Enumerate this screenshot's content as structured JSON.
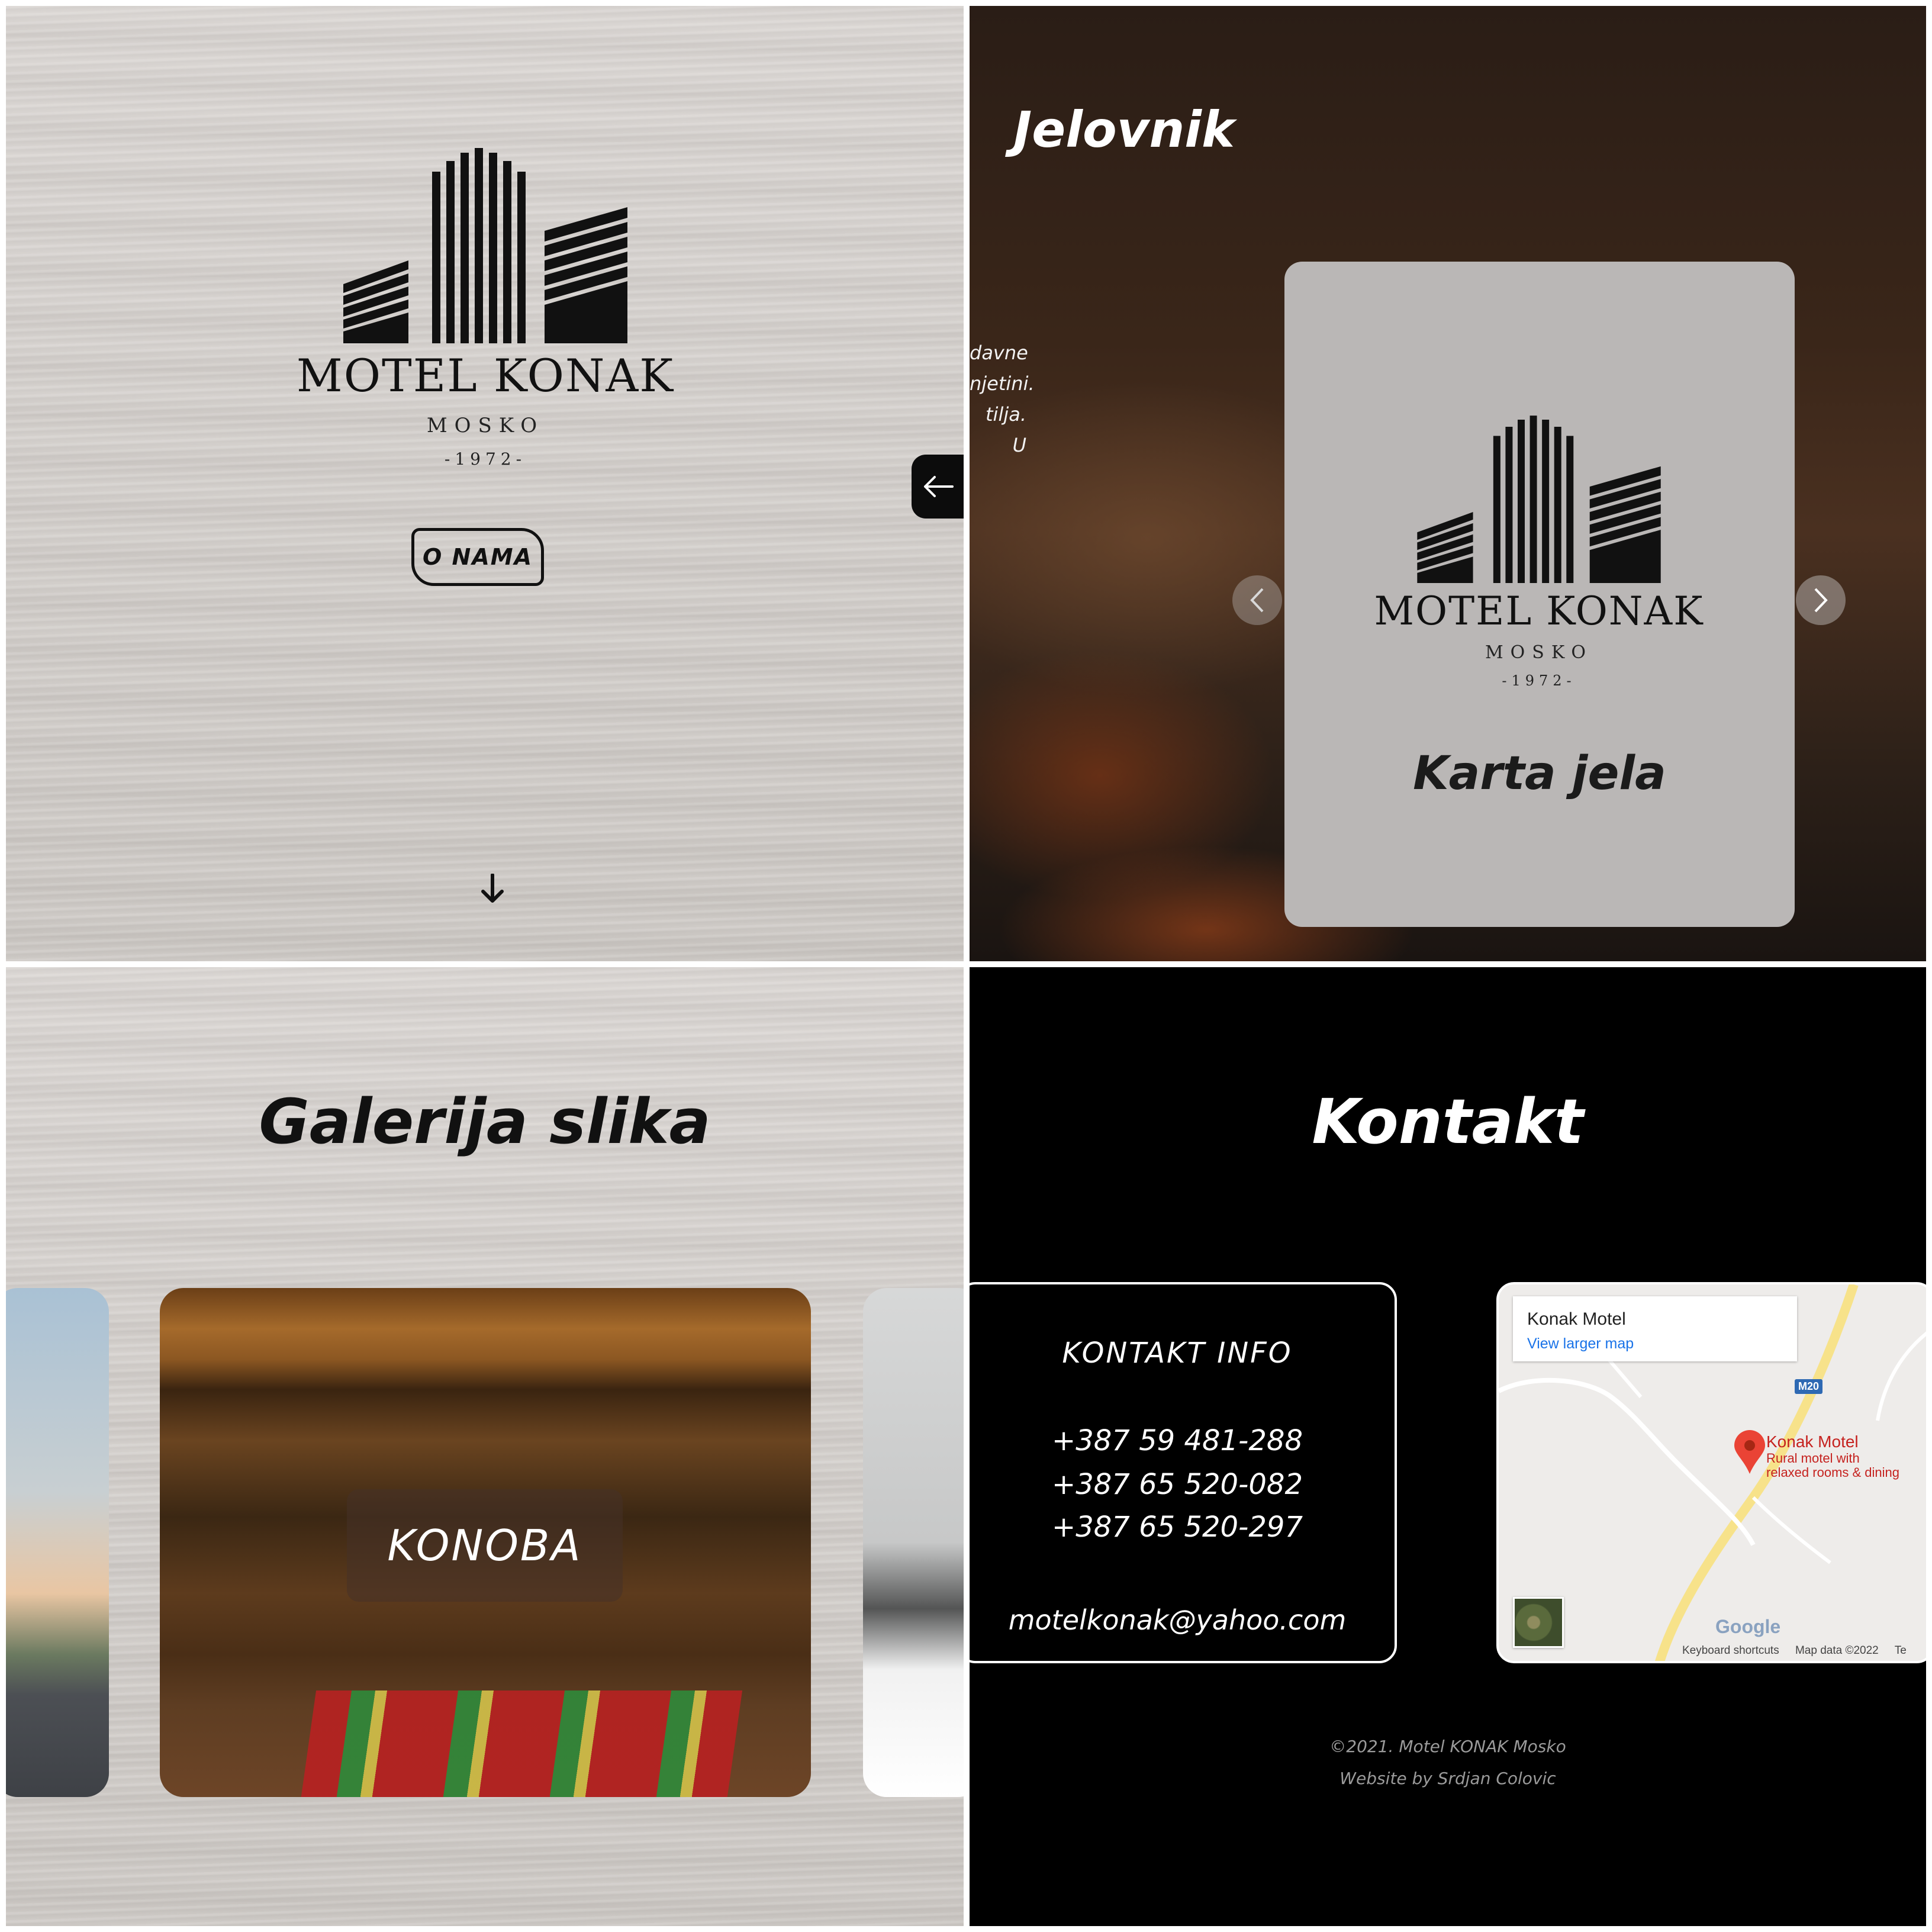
{
  "hero": {
    "brand": "MOTEL KONAK",
    "location": "MOSKO",
    "year": "-1972-",
    "about_button": "O NAMA"
  },
  "menu_section": {
    "title": "Jelovnik",
    "snippet_lines": [
      "davne",
      "njetini.",
      "tilja. U"
    ],
    "card_brand": "MOTEL KONAK",
    "card_location": "MOSKO",
    "card_year": "-1972-",
    "card_title": "Karta jela"
  },
  "gallery": {
    "title": "Galerija slika",
    "current_slide": "KONOBA"
  },
  "contact": {
    "title": "Kontakt",
    "info_heading": "KONTAKT INFO",
    "phones": [
      "+387 59 481-288",
      "+387 65 520-082",
      "+387 65 520-297"
    ],
    "email": "motelkonak@yahoo.com",
    "map": {
      "place_title": "Konak Motel",
      "view_larger": "View larger map",
      "road_badge": "M20",
      "marker_name": "Konak Motel",
      "marker_desc_1": "Rural motel with",
      "marker_desc_2": "relaxed rooms & dining",
      "google": "Google",
      "keyboard": "Keyboard shortcuts",
      "map_data": "Map data ©2022",
      "terms": "Te"
    },
    "footer_line1": "©2021. Motel KONAK Mosko",
    "footer_line2": "Website by Srdjan Colovic"
  }
}
